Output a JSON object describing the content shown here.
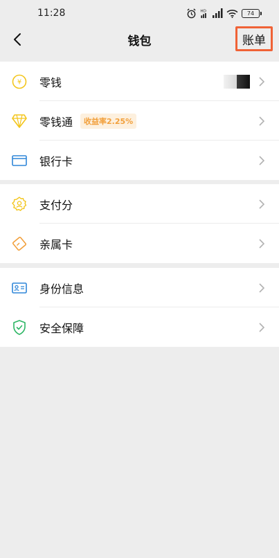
{
  "status_bar": {
    "time": "11:28",
    "battery": "74",
    "icons": [
      "alarm-icon",
      "hd-signal-icon",
      "cellular-signal-icon",
      "wifi-icon",
      "battery-icon"
    ]
  },
  "nav": {
    "title": "钱包",
    "bill_label": "账单",
    "back_icon": "chevron-left-icon",
    "bill_highlight_color": "#f06236"
  },
  "groups": [
    {
      "items": [
        {
          "label": "零钱",
          "icon": "coin-yen-icon",
          "icon_color": "#f3c51b"
        },
        {
          "label": "零钱通",
          "icon": "diamond-icon",
          "icon_color": "#f3c51b",
          "badge": "收益率2.25%"
        },
        {
          "label": "银行卡",
          "icon": "bank-card-icon",
          "icon_color": "#2f86d8"
        }
      ]
    },
    {
      "items": [
        {
          "label": "支付分",
          "icon": "pay-score-icon",
          "icon_color": "#f3c51b"
        },
        {
          "label": "亲属卡",
          "icon": "family-card-icon",
          "icon_color": "#f2a03c"
        }
      ]
    },
    {
      "items": [
        {
          "label": "身份信息",
          "icon": "id-card-icon",
          "icon_color": "#2f86d8"
        },
        {
          "label": "安全保障",
          "icon": "shield-check-icon",
          "icon_color": "#2bb563"
        }
      ]
    }
  ],
  "colors": {
    "page_bg": "#ededed",
    "row_bg": "#ffffff",
    "badge_bg": "#fdf0de",
    "badge_text": "#f2a03c"
  }
}
